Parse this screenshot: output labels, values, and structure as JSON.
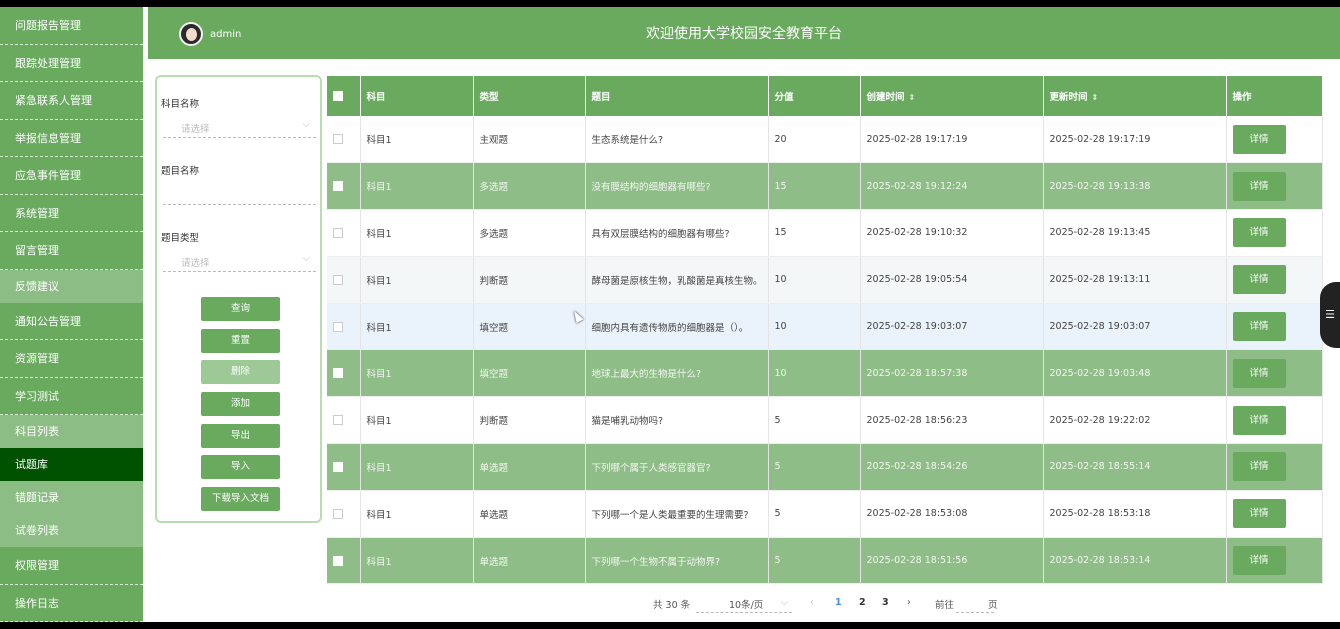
{
  "header": {
    "username": "admin",
    "title": "欢迎使用大学校园安全教育平台"
  },
  "sidebar": {
    "items": [
      {
        "label": "问题报告管理",
        "kind": "normal"
      },
      {
        "label": "跟踪处理管理",
        "kind": "normal"
      },
      {
        "label": "紧急联系人管理",
        "kind": "normal"
      },
      {
        "label": "举报信息管理",
        "kind": "normal"
      },
      {
        "label": "应急事件管理",
        "kind": "normal"
      },
      {
        "label": "系统管理",
        "kind": "normal"
      },
      {
        "label": "留言管理",
        "kind": "normal"
      },
      {
        "label": "反馈建议",
        "kind": "sub"
      },
      {
        "label": "通知公告管理",
        "kind": "normal"
      },
      {
        "label": "资源管理",
        "kind": "normal"
      },
      {
        "label": "学习测试",
        "kind": "normal"
      },
      {
        "label": "科目列表",
        "kind": "sub"
      },
      {
        "label": "试题库",
        "kind": "active"
      },
      {
        "label": "错题记录",
        "kind": "sub"
      },
      {
        "label": "试卷列表",
        "kind": "sub"
      },
      {
        "label": "权限管理",
        "kind": "normal"
      },
      {
        "label": "操作日志",
        "kind": "normal"
      }
    ]
  },
  "search": {
    "subject_label": "科目名称",
    "subject_placeholder": "请选择",
    "question_label": "题目名称",
    "type_label": "题目类型",
    "type_placeholder": "请选择",
    "buttons": {
      "query": "查询",
      "reset": "重置",
      "delete": "删除",
      "add": "添加",
      "export": "导出",
      "import": "导入",
      "download": "下载导入文档"
    }
  },
  "table": {
    "headers": {
      "subject": "科目",
      "type": "类型",
      "question": "题目",
      "score": "分值",
      "created": "创建时间",
      "updated": "更新时间",
      "action": "操作"
    },
    "detail_label": "详情",
    "rows": [
      {
        "subject": "科目1",
        "type": "主观题",
        "question": "生态系统是什么?",
        "score": "20",
        "created": "2025-02-28 19:17:19",
        "updated": "2025-02-28 19:17:19",
        "style": "row-white"
      },
      {
        "subject": "科目1",
        "type": "多选题",
        "question": "没有膜结构的细胞器有哪些?",
        "score": "15",
        "created": "2025-02-28 19:12:24",
        "updated": "2025-02-28 19:13:38",
        "style": "row-green"
      },
      {
        "subject": "科目1",
        "type": "多选题",
        "question": "具有双层膜结构的细胞器有哪些?",
        "score": "15",
        "created": "2025-02-28 19:10:32",
        "updated": "2025-02-28 19:13:45",
        "style": "row-white"
      },
      {
        "subject": "科目1",
        "type": "判断题",
        "question": "酵母菌是原核生物，乳酸菌是真核生物。",
        "score": "10",
        "created": "2025-02-28 19:05:54",
        "updated": "2025-02-28 19:13:11",
        "style": "row-pale"
      },
      {
        "subject": "科目1",
        "type": "填空题",
        "question": "细胞内具有遗传物质的细胞器是（）。",
        "score": "10",
        "created": "2025-02-28 19:03:07",
        "updated": "2025-02-28 19:03:07",
        "style": "row-hover"
      },
      {
        "subject": "科目1",
        "type": "填空题",
        "question": "地球上最大的生物是什么?",
        "score": "10",
        "created": "2025-02-28 18:57:38",
        "updated": "2025-02-28 19:03:48",
        "style": "row-green"
      },
      {
        "subject": "科目1",
        "type": "判断题",
        "question": "猫是哺乳动物吗?",
        "score": "5",
        "created": "2025-02-28 18:56:23",
        "updated": "2025-02-28 19:22:02",
        "style": "row-white"
      },
      {
        "subject": "科目1",
        "type": "单选题",
        "question": "下列哪个属于人类感官器官?",
        "score": "5",
        "created": "2025-02-28 18:54:26",
        "updated": "2025-02-28 18:55:14",
        "style": "row-green"
      },
      {
        "subject": "科目1",
        "type": "单选题",
        "question": "下列哪一个是人类最重要的生理需要?",
        "score": "5",
        "created": "2025-02-28 18:53:08",
        "updated": "2025-02-28 18:53:18",
        "style": "row-white"
      },
      {
        "subject": "科目1",
        "type": "单选题",
        "question": "下列哪一个生物不属于动物界?",
        "score": "5",
        "created": "2025-02-28 18:51:56",
        "updated": "2025-02-28 18:53:14",
        "style": "row-green"
      }
    ]
  },
  "pagination": {
    "total": "共 30 条",
    "page_size": "10条/页",
    "prev": "‹",
    "pages": [
      "1",
      "2",
      "3"
    ],
    "next": "›",
    "goto_label": "前往",
    "page_suffix": "页"
  },
  "float_tab": {
    "icon": "list-icon",
    "glyph": "☰"
  },
  "icons": {
    "sort": "sort-icon",
    "caret": "chevron-down-icon",
    "cursor": "mouse-cursor"
  }
}
